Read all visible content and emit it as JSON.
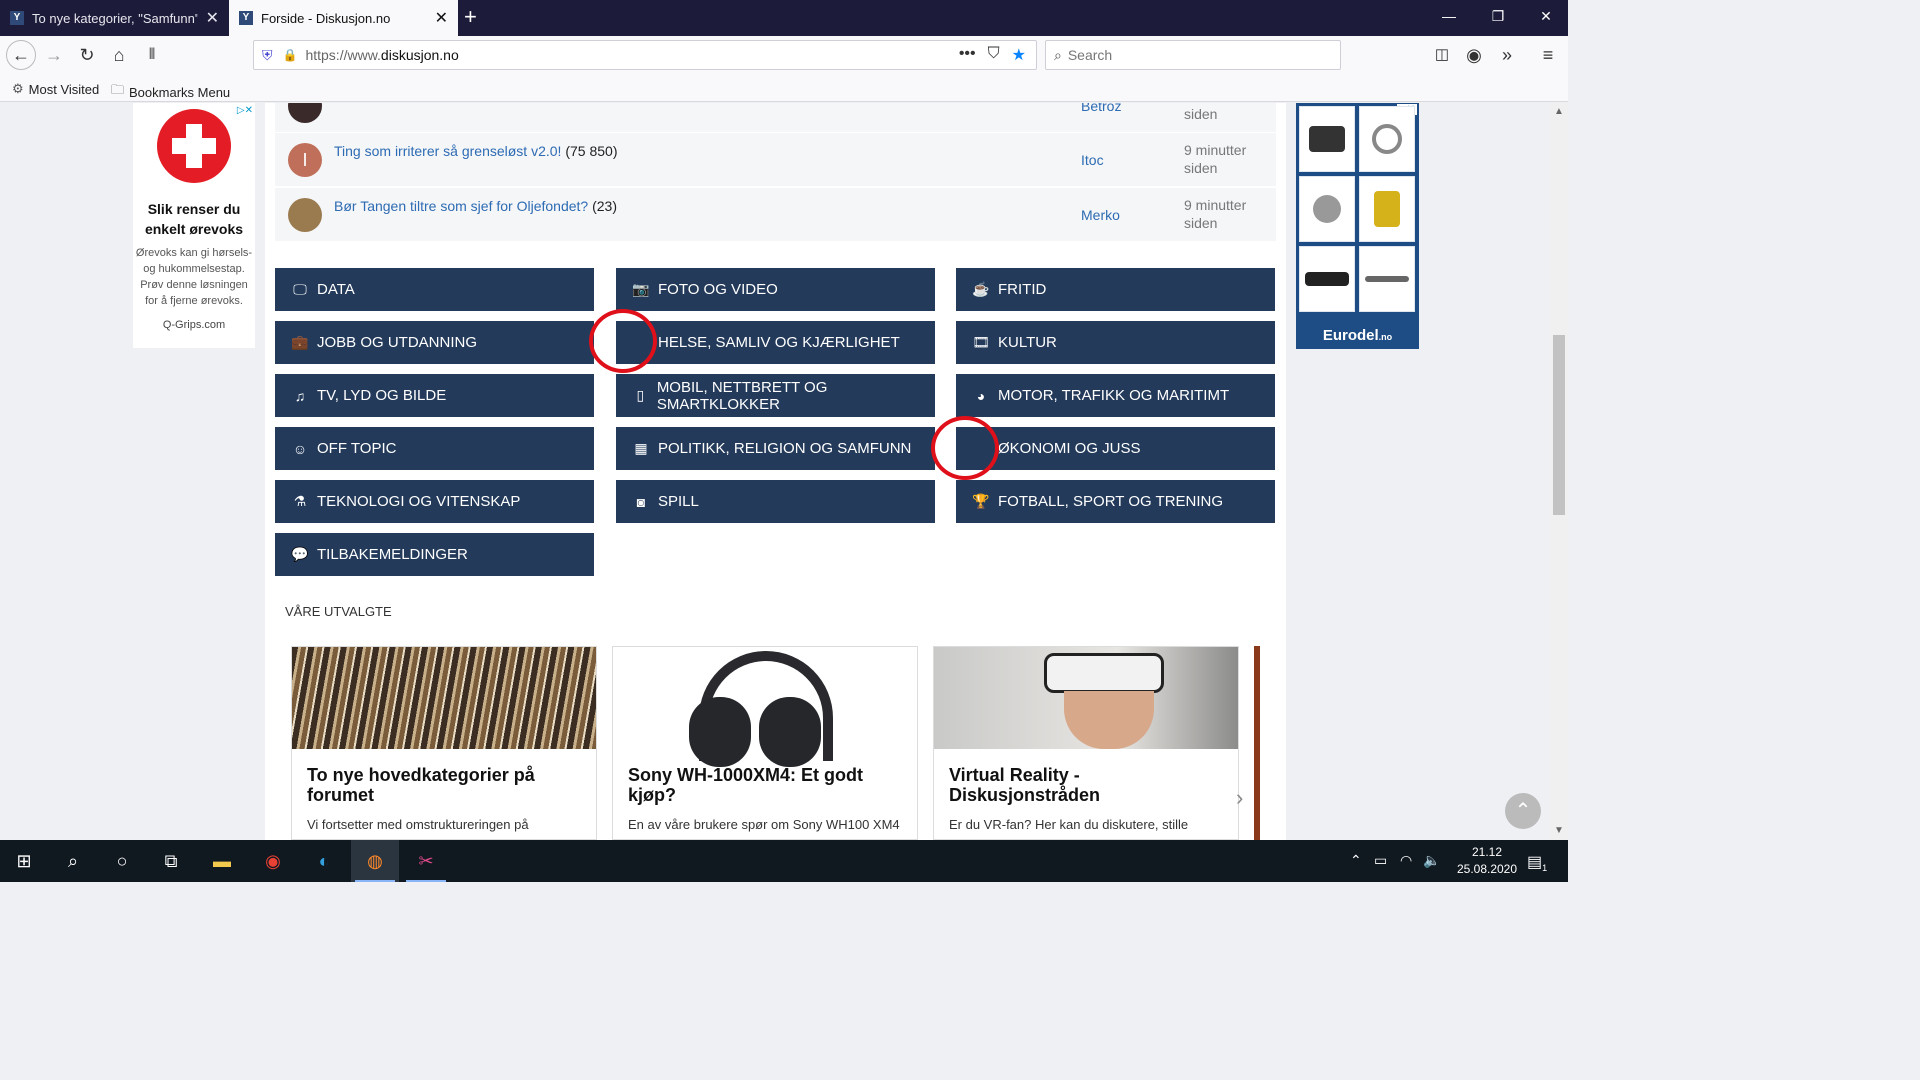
{
  "browser": {
    "tabs": [
      {
        "title": "To nye kategorier, \"Samfunn\" e",
        "active": false
      },
      {
        "title": "Forside - Diskusjon.no",
        "active": true
      }
    ],
    "url_prefix": "https://www.",
    "url_domain": "diskusjon.no",
    "search_placeholder": "Search",
    "bookmarks": [
      {
        "label": "Most Visited",
        "icon": "gear-icon"
      },
      {
        "label": "Bookmarks Menu",
        "icon": "folder-icon"
      }
    ]
  },
  "ads": {
    "left": {
      "title": "Slik renser du enkelt ørevoks",
      "text": "Ørevoks kan gi hørsels- og hukommelsestap. Prøv denne løsningen for å fjerne ørevoks.",
      "brand": "Q-Grips.com"
    },
    "right": {
      "brand": "Eurodel",
      "brand_suffix": ".no"
    }
  },
  "topics": [
    {
      "title": "Ting som irriterer så grenseløst v2.0!",
      "count": "(75 850)",
      "author": "Itoc",
      "time": "9 minutter siden",
      "avatar_letter": "I",
      "avatar_color": "#c0705a"
    },
    {
      "title": "Bør Tangen tiltre som sjef for Oljefondet?",
      "count": "(23)",
      "author": "Merko",
      "time": "9 minutter siden",
      "avatar_letter": "",
      "avatar_color": "#9a7b4f"
    }
  ],
  "partial_topic": {
    "author": "Betroz",
    "time": "siden"
  },
  "categories": [
    {
      "label": "DATA",
      "icon": "monitor-icon",
      "glyph": "🖵"
    },
    {
      "label": "FOTO OG VIDEO",
      "icon": "camera-icon",
      "glyph": "📷"
    },
    {
      "label": "FRITID",
      "icon": "coffee-icon",
      "glyph": "☕"
    },
    {
      "label": "JOBB OG UTDANNING",
      "icon": "briefcase-icon",
      "glyph": "💼"
    },
    {
      "label": "HELSE, SAMLIV OG KJÆRLIGHET",
      "icon": "",
      "glyph": ""
    },
    {
      "label": "KULTUR",
      "icon": "film-icon",
      "glyph": "🎞"
    },
    {
      "label": "TV, LYD OG BILDE",
      "icon": "music-icon",
      "glyph": "♫"
    },
    {
      "label": "MOBIL, NETTBRETT OG SMARTKLOKKER",
      "icon": "mobile-icon",
      "glyph": "▯"
    },
    {
      "label": "MOTOR, TRAFIKK OG MARITIMT",
      "icon": "dashboard-icon",
      "glyph": "◕"
    },
    {
      "label": "OFF TOPIC",
      "icon": "smile-icon",
      "glyph": "☺"
    },
    {
      "label": "POLITIKK, RELIGION OG SAMFUNN",
      "icon": "building-icon",
      "glyph": "▦"
    },
    {
      "label": "ØKONOMI OG JUSS",
      "icon": "",
      "glyph": ""
    },
    {
      "label": "TEKNOLOGI OG VITENSKAP",
      "icon": "flask-icon",
      "glyph": "⚗"
    },
    {
      "label": "SPILL",
      "icon": "gamepad-icon",
      "glyph": "◙"
    },
    {
      "label": "FOTBALL, SPORT OG TRENING",
      "icon": "trophy-icon",
      "glyph": "🏆"
    },
    {
      "label": "TILBAKEMELDINGER",
      "icon": "comments-icon",
      "glyph": "💬"
    }
  ],
  "featured": {
    "header": "VÅRE UTVALGTE",
    "cards": [
      {
        "title": "To nye hovedkategorier på forumet",
        "text": "Vi fortsetter med omstruktureringen på"
      },
      {
        "title": "Sony WH-1000XM4: Et godt kjøp?",
        "text": "En av våre brukere spør om Sony WH100 XM4"
      },
      {
        "title": "Virtual Reality - Diskusjonstråden",
        "text": "Er du VR-fan? Her kan du diskutere, stille"
      }
    ]
  },
  "taskbar": {
    "time": "21.12",
    "date": "25.08.2020",
    "notification_count": "1"
  }
}
